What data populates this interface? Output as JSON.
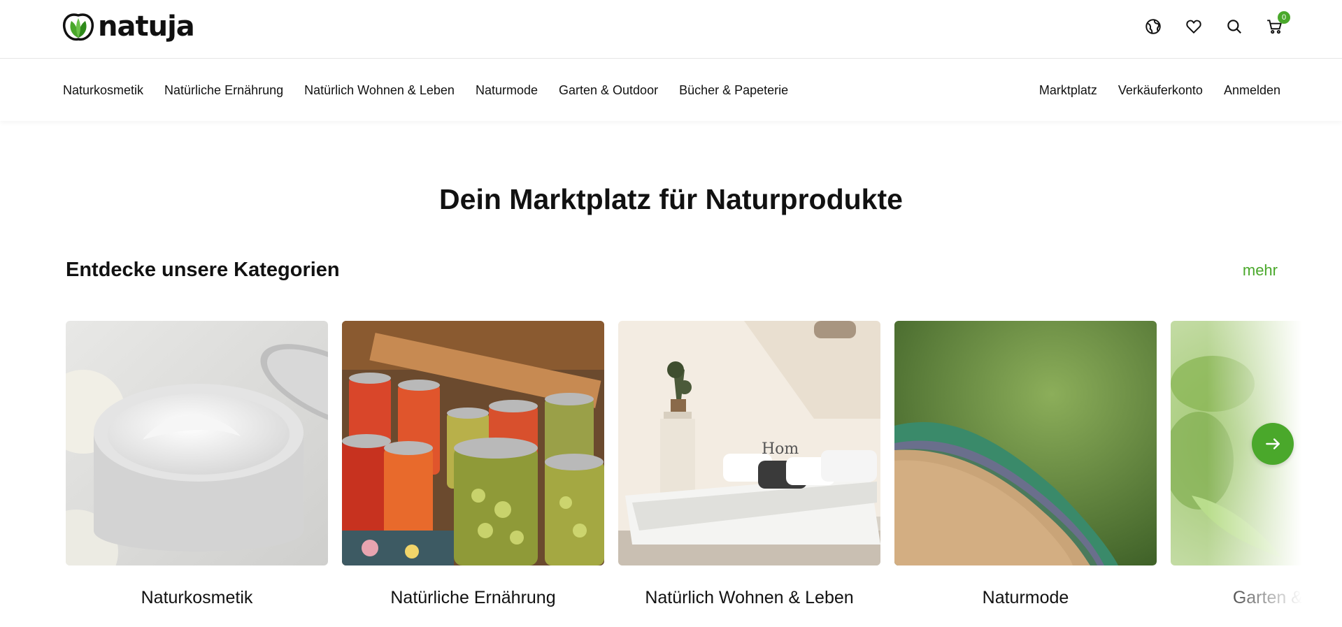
{
  "brand": {
    "name": "natuja",
    "accent": "#4aa82b"
  },
  "header_icons": [
    {
      "name": "globe-icon"
    },
    {
      "name": "heart-icon"
    },
    {
      "name": "search-icon"
    },
    {
      "name": "cart-icon",
      "badge": "0"
    }
  ],
  "nav": {
    "left": [
      "Naturkosmetik",
      "Natürliche Ernährung",
      "Natürlich Wohnen & Leben",
      "Naturmode",
      "Garten & Outdoor",
      "Bücher & Papeterie"
    ],
    "right": [
      "Marktplatz",
      "Verkäuferkonto",
      "Anmelden"
    ]
  },
  "hero": {
    "title": "Dein Marktplatz für Naturprodukte"
  },
  "categories": {
    "title": "Entdecke unsere Kategorien",
    "more": "mehr",
    "items": [
      {
        "label": "Naturkosmetik",
        "image": "cream-jar"
      },
      {
        "label": "Natürliche Ernährung",
        "image": "preserve-jars"
      },
      {
        "label": "Natürlich Wohnen & Leben",
        "image": "bedroom"
      },
      {
        "label": "Naturmode",
        "image": "fabric-layers"
      },
      {
        "label": "Garten & Outdoor",
        "image": "green-leaves"
      }
    ]
  }
}
